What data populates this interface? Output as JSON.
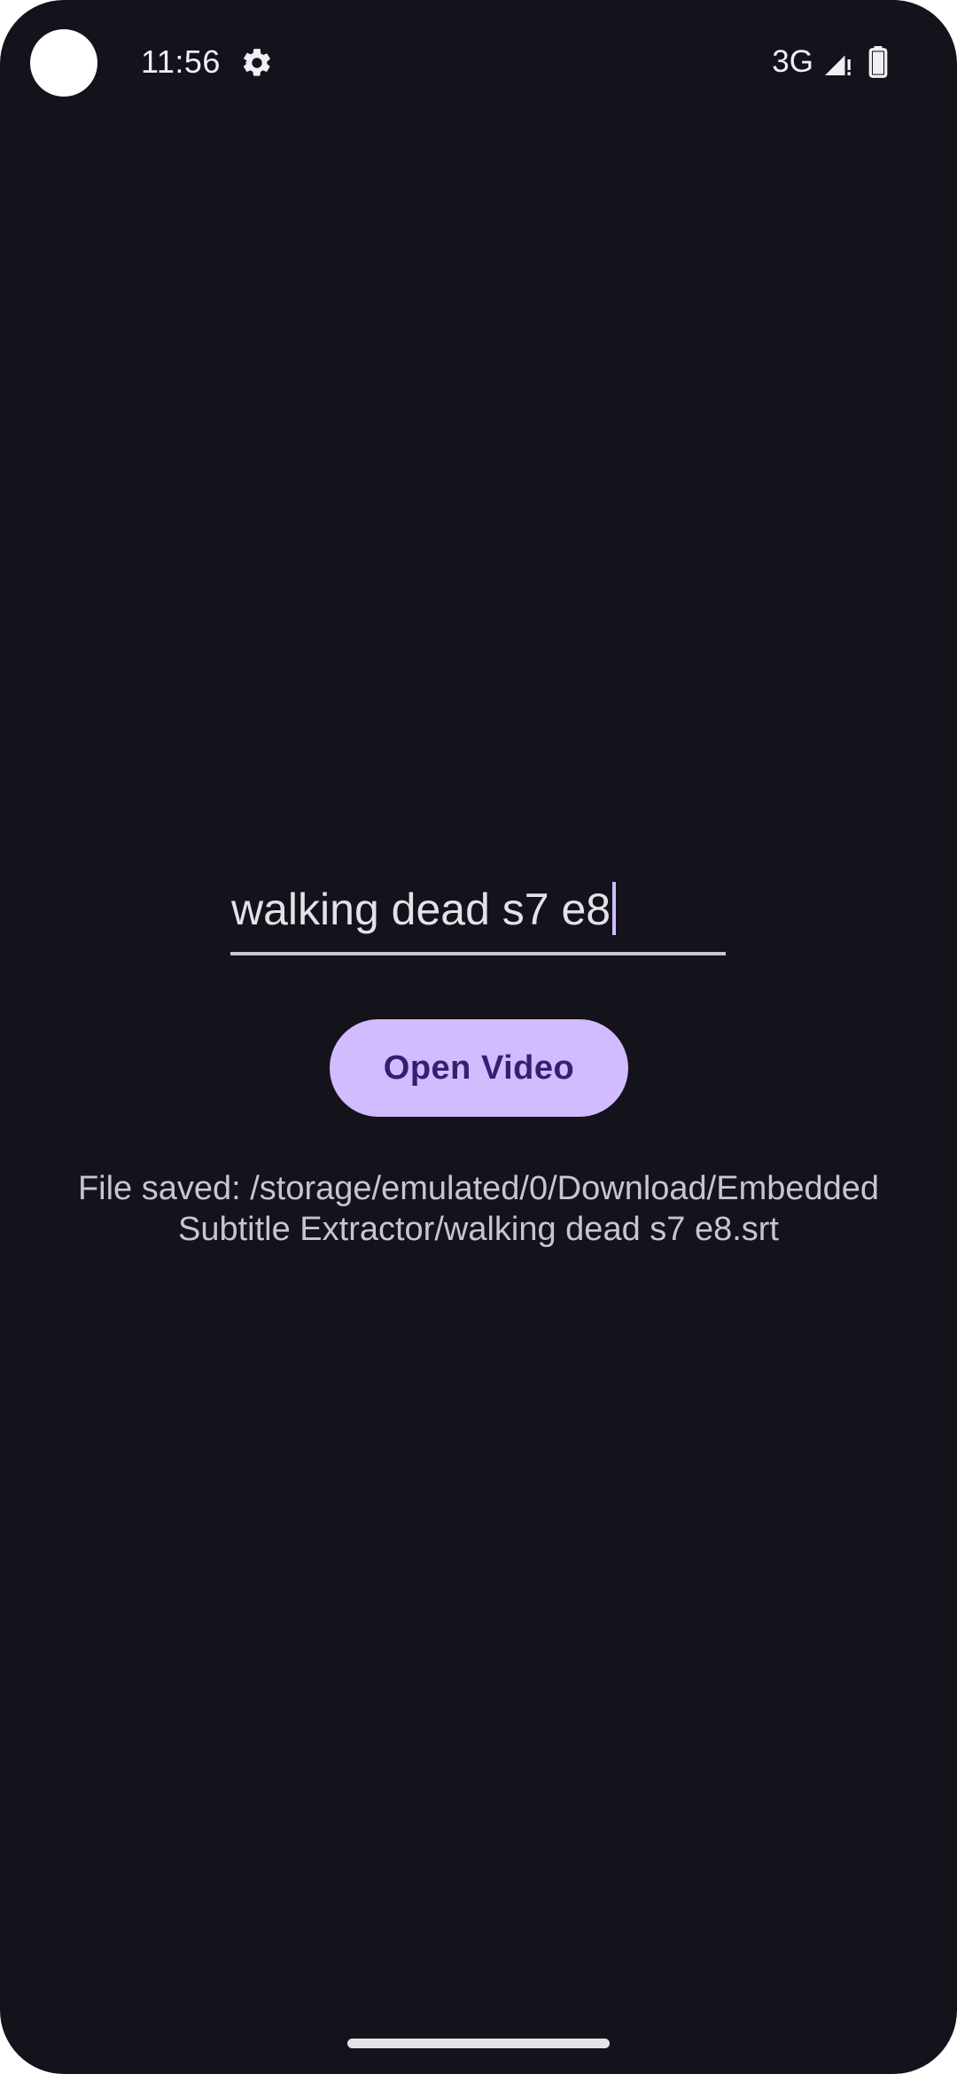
{
  "status_bar": {
    "time": "11:56",
    "network_type": "3G",
    "icons": [
      "settings-icon",
      "signal-icon",
      "battery-icon"
    ]
  },
  "main": {
    "filename_input": {
      "value": "walking dead s7 e8"
    },
    "open_video_button": {
      "label": "Open Video"
    },
    "status_message": "File saved: /storage/emulated/0/Download/Embedded Subtitle Extractor/walking dead s7 e8.srt"
  },
  "colors": {
    "background": "#14121a",
    "accent": "#d0bcff",
    "button_text": "#381e72",
    "text_primary": "#e6e1e9",
    "text_secondary": "#cac4d0"
  }
}
